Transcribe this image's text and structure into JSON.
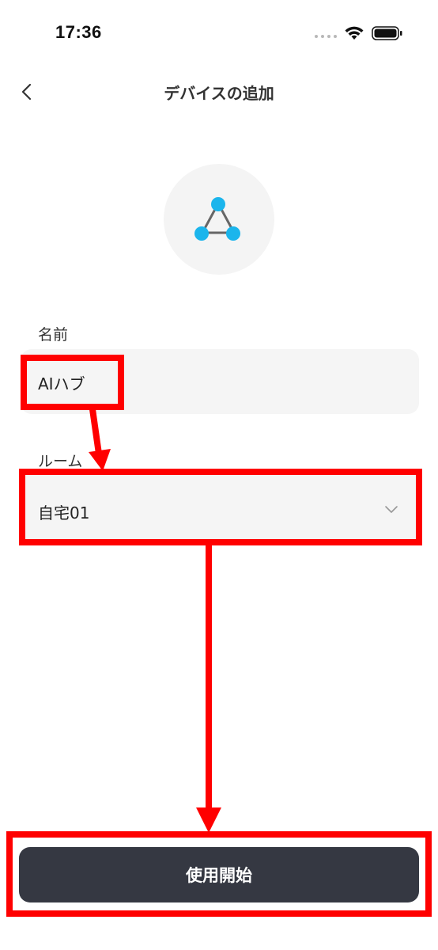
{
  "status_bar": {
    "time": "17:36"
  },
  "nav": {
    "title": "デバイスの追加"
  },
  "form": {
    "name_label": "名前",
    "name_value": "AIハブ",
    "room_label": "ルーム",
    "room_value": "自宅01"
  },
  "actions": {
    "start_label": "使用開始"
  },
  "colors": {
    "accent": "#1BB5EC",
    "button_bg": "#353842",
    "field_bg": "#f5f5f5",
    "annotation": "#ff0000"
  },
  "icons": {
    "device": "hub-network-icon",
    "back": "chevron-left-icon",
    "select": "chevron-down-icon"
  }
}
